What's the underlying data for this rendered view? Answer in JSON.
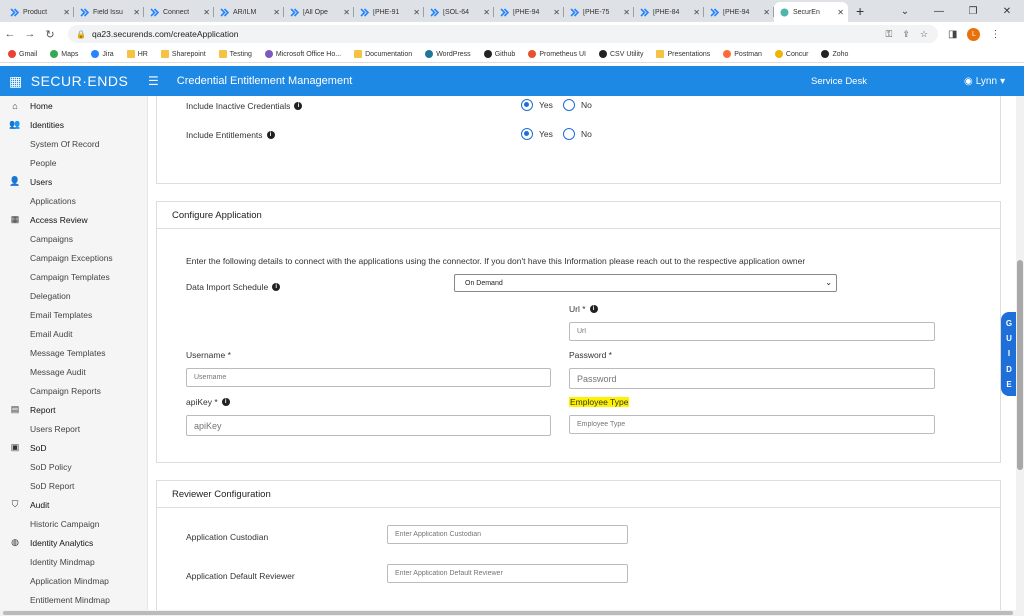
{
  "browser": {
    "tabs": [
      {
        "label": "Product"
      },
      {
        "label": "Field Issu"
      },
      {
        "label": "Connect"
      },
      {
        "label": "AR/ILM"
      },
      {
        "label": "[All Ope"
      },
      {
        "label": "[PHE-91"
      },
      {
        "label": "[SOL-64"
      },
      {
        "label": "[PHE-94"
      },
      {
        "label": "[PHE-75"
      },
      {
        "label": "[PHE-84"
      },
      {
        "label": "[PHE-94"
      },
      {
        "label": "SecurEn"
      }
    ],
    "url": "qa23.securends.com/createApplication",
    "profile_initial": "L",
    "bookmarks": [
      {
        "label": "Gmail"
      },
      {
        "label": "Maps"
      },
      {
        "label": "Jira"
      },
      {
        "label": "HR"
      },
      {
        "label": "Sharepoint"
      },
      {
        "label": "Testing"
      },
      {
        "label": "Microsoft Office Ho..."
      },
      {
        "label": "Documentation"
      },
      {
        "label": "WordPress"
      },
      {
        "label": "Github"
      },
      {
        "label": "Prometheus UI"
      },
      {
        "label": "CSV Utility"
      },
      {
        "label": "Presentations"
      },
      {
        "label": "Postman"
      },
      {
        "label": "Concur"
      },
      {
        "label": "Zoho"
      }
    ]
  },
  "header": {
    "brand": "SECUR·ENDS",
    "title": "Credential Entitlement Management",
    "service_desk": "Service Desk",
    "user": "Lynn"
  },
  "sidebar": {
    "items": [
      {
        "label": "Home",
        "type": "top",
        "icon": "home-icon",
        "glyph": "⌂"
      },
      {
        "label": "Identities",
        "type": "top",
        "icon": "people-icon",
        "glyph": "👥"
      },
      {
        "label": "System Of Record",
        "type": "sub"
      },
      {
        "label": "People",
        "type": "sub"
      },
      {
        "label": "Users",
        "type": "top",
        "icon": "user-icon",
        "glyph": "👤"
      },
      {
        "label": "Applications",
        "type": "sub"
      },
      {
        "label": "Access Review",
        "type": "top",
        "icon": "grid-icon",
        "glyph": "▦"
      },
      {
        "label": "Campaigns",
        "type": "sub"
      },
      {
        "label": "Campaign Exceptions",
        "type": "sub"
      },
      {
        "label": "Campaign Templates",
        "type": "sub"
      },
      {
        "label": "Delegation",
        "type": "sub"
      },
      {
        "label": "Email Templates",
        "type": "sub"
      },
      {
        "label": "Email Audit",
        "type": "sub"
      },
      {
        "label": "Message Templates",
        "type": "sub"
      },
      {
        "label": "Message Audit",
        "type": "sub"
      },
      {
        "label": "Campaign Reports",
        "type": "sub"
      },
      {
        "label": "Report",
        "type": "top",
        "icon": "report-icon",
        "glyph": "▤"
      },
      {
        "label": "Users Report",
        "type": "sub"
      },
      {
        "label": "SoD",
        "type": "top",
        "icon": "sod-icon",
        "glyph": "▣"
      },
      {
        "label": "SoD Policy",
        "type": "sub"
      },
      {
        "label": "SoD Report",
        "type": "sub"
      },
      {
        "label": "Audit",
        "type": "top",
        "icon": "shield-icon",
        "glyph": "⛉"
      },
      {
        "label": "Historic Campaign",
        "type": "sub"
      },
      {
        "label": "Identity Analytics",
        "type": "top",
        "icon": "analytics-icon",
        "glyph": "◍"
      },
      {
        "label": "Identity Mindmap",
        "type": "sub"
      },
      {
        "label": "Application Mindmap",
        "type": "sub"
      },
      {
        "label": "Entitlement Mindmap",
        "type": "sub"
      }
    ]
  },
  "options_card": {
    "inactive_label": "Include Inactive Credentials",
    "entitlements_label": "Include Entitlements",
    "yes": "Yes",
    "no": "No"
  },
  "configure": {
    "title": "Configure Application",
    "intro": "Enter the following details to connect with the applications using the connector. If you don't have this Information please reach out to the respective application owner",
    "schedule_label": "Data Import Schedule",
    "schedule_value": "On Demand",
    "url_label": "Url *",
    "url_placeholder": "Url",
    "username_label": "Username *",
    "username_placeholder": "Username",
    "password_label": "Password *",
    "password_placeholder": "Password",
    "apikey_label": "apiKey *",
    "apikey_placeholder": "apiKey",
    "employee_type_label": "Employee Type",
    "employee_type_placeholder": "Employee Type"
  },
  "reviewer": {
    "title": "Reviewer Configuration",
    "custodian_label": "Application Custodian",
    "custodian_placeholder": "Enter Application Custodian",
    "default_reviewer_label": "Application Default Reviewer",
    "default_reviewer_placeholder": "Enter Application Default Reviewer"
  },
  "guide": {
    "letters": [
      "G",
      "U",
      "I",
      "D",
      "E"
    ]
  },
  "colors": {
    "primary": "#1e88e5",
    "radio": "#1e6fd9",
    "highlight": "#fff200"
  }
}
